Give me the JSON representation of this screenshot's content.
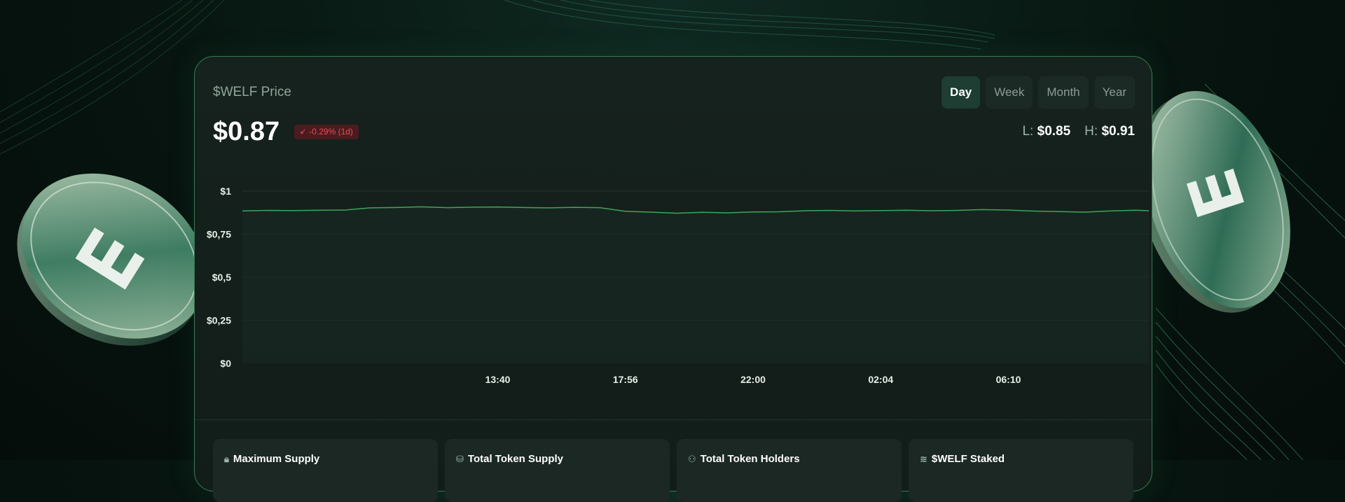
{
  "card": {
    "title": "$WELF Price",
    "price": "$0.87",
    "change": "-0.29% (1d)",
    "change_icon": "arrow-down-left-icon",
    "tabs": [
      {
        "label": "Day",
        "active": true
      },
      {
        "label": "Week",
        "active": false
      },
      {
        "label": "Month",
        "active": false
      },
      {
        "label": "Year",
        "active": false
      }
    ],
    "low_label": "L:",
    "low_value": "$0.85",
    "high_label": "H:",
    "high_value": "$0.91"
  },
  "stats": [
    {
      "icon": "lock-icon",
      "label": "Maximum Supply"
    },
    {
      "icon": "coins-icon",
      "label": "Total Token Supply"
    },
    {
      "icon": "users-icon",
      "label": "Total Token Holders"
    },
    {
      "icon": "layers-icon",
      "label": "$WELF Staked"
    }
  ],
  "colors": {
    "accent": "#3ea55a",
    "negative": "#ef4b55",
    "card_border": "#3a7a52"
  },
  "chart_data": {
    "type": "line",
    "title": "",
    "xlabel": "",
    "ylabel": "",
    "ylim": [
      0,
      1
    ],
    "y_ticks": [
      {
        "value": 0,
        "label": "$0"
      },
      {
        "value": 0.25,
        "label": "$0,25"
      },
      {
        "value": 0.5,
        "label": "$0,5"
      },
      {
        "value": 0.75,
        "label": "$0,75"
      },
      {
        "value": 1,
        "label": "$1"
      }
    ],
    "x_ticks": [
      "13:40",
      "17:56",
      "22:00",
      "02:04",
      "06:10"
    ],
    "x_tick_positions": [
      2,
      3,
      4,
      5,
      6
    ],
    "xlim": [
      0,
      7.1
    ],
    "grid": true,
    "series": [
      {
        "x": [
          0.0,
          0.2,
          0.4,
          0.6,
          0.8,
          1.0,
          1.2,
          1.4,
          1.6,
          1.8,
          2.0,
          2.2,
          2.4,
          2.6,
          2.8,
          3.0,
          3.2,
          3.4,
          3.6,
          3.8,
          4.0,
          4.2,
          4.4,
          4.6,
          4.8,
          5.0,
          5.2,
          5.4,
          5.6,
          5.8,
          6.0,
          6.2,
          6.4,
          6.6,
          6.8,
          7.0,
          7.1
        ],
        "y": [
          0.885,
          0.888,
          0.887,
          0.889,
          0.89,
          0.903,
          0.905,
          0.909,
          0.904,
          0.907,
          0.908,
          0.905,
          0.903,
          0.906,
          0.904,
          0.883,
          0.878,
          0.872,
          0.877,
          0.874,
          0.879,
          0.88,
          0.886,
          0.888,
          0.885,
          0.887,
          0.889,
          0.886,
          0.888,
          0.893,
          0.89,
          0.884,
          0.881,
          0.878,
          0.885,
          0.889,
          0.886
        ]
      }
    ]
  }
}
